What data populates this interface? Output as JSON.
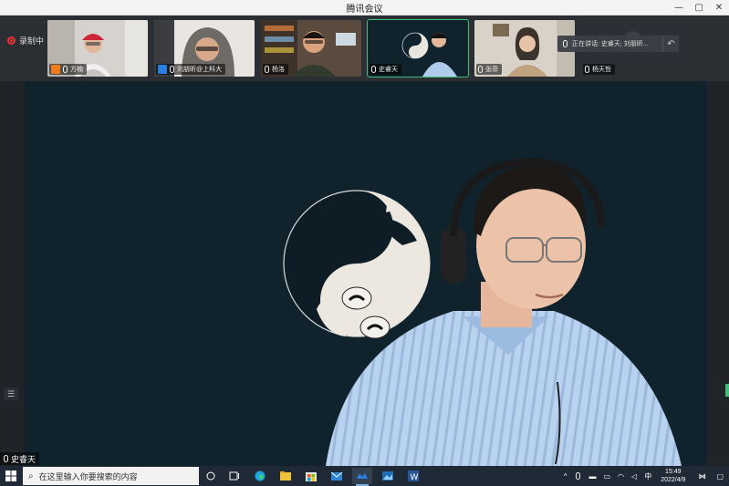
{
  "window": {
    "title": "腾讯会议",
    "min": "—",
    "max": "▢",
    "close": "✕"
  },
  "recording": {
    "label": "录制中"
  },
  "participants": [
    {
      "name": "方楠",
      "role": "host"
    },
    {
      "name": "刘朋昕@上科大",
      "role": "cohost"
    },
    {
      "name": "杨洛",
      "role": "member"
    },
    {
      "name": "史睿天",
      "role": "member",
      "active": true
    },
    {
      "name": "张菲",
      "role": "member"
    },
    {
      "name": "杨天哲",
      "role": "member"
    }
  ],
  "speaking": {
    "text": "正在讲话: 史睿天; 刘朋昕..."
  },
  "main": {
    "speaker_name": "史睿天"
  },
  "taskbar": {
    "search_placeholder": "在这里输入你要搜索的内容",
    "ime": "中",
    "time": "15:49",
    "date": "2022/4/9"
  },
  "colors": {
    "accent": "#3ec07a",
    "host": "#f07d1a",
    "cohost": "#2a7de1"
  }
}
